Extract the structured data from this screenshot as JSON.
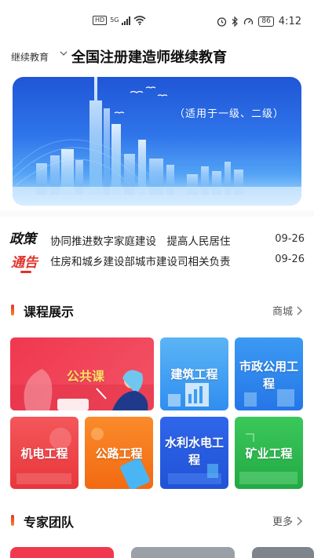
{
  "status_bar": {
    "hd": "HD",
    "network": "5G",
    "battery": "86",
    "time": "4:12"
  },
  "header": {
    "category": "继续教育",
    "title": "全国注册建造师继续教育"
  },
  "banner": {
    "caption": "（适用于一级、二级）"
  },
  "news": {
    "badge_line1": "政策",
    "badge_line2": "通告",
    "items": [
      {
        "title": "协同推进数字家庭建设　提高人民居住",
        "date": "09-26"
      },
      {
        "title": "住房和城乡建设部城市建设司相关负责",
        "date": "09-26"
      }
    ]
  },
  "courses": {
    "title": "课程展示",
    "more": "商城",
    "tiles": [
      {
        "label": "公共课",
        "color": "#f03e55"
      },
      {
        "label": "建筑工程",
        "color": "#3d9bf0"
      },
      {
        "label": "市政公用工程",
        "color": "#2f8ff0"
      },
      {
        "label": "机电工程",
        "color": "#f0454a"
      },
      {
        "label": "公路工程",
        "color": "#f77a1c"
      },
      {
        "label": "水利水电工程",
        "color": "#2c63e6"
      },
      {
        "label": "矿业工程",
        "color": "#2db84c"
      }
    ]
  },
  "experts": {
    "title": "专家团队",
    "more": "更多"
  },
  "colors": {
    "accent_red": "#e2322b",
    "banner_blue": "#2f74ea"
  }
}
